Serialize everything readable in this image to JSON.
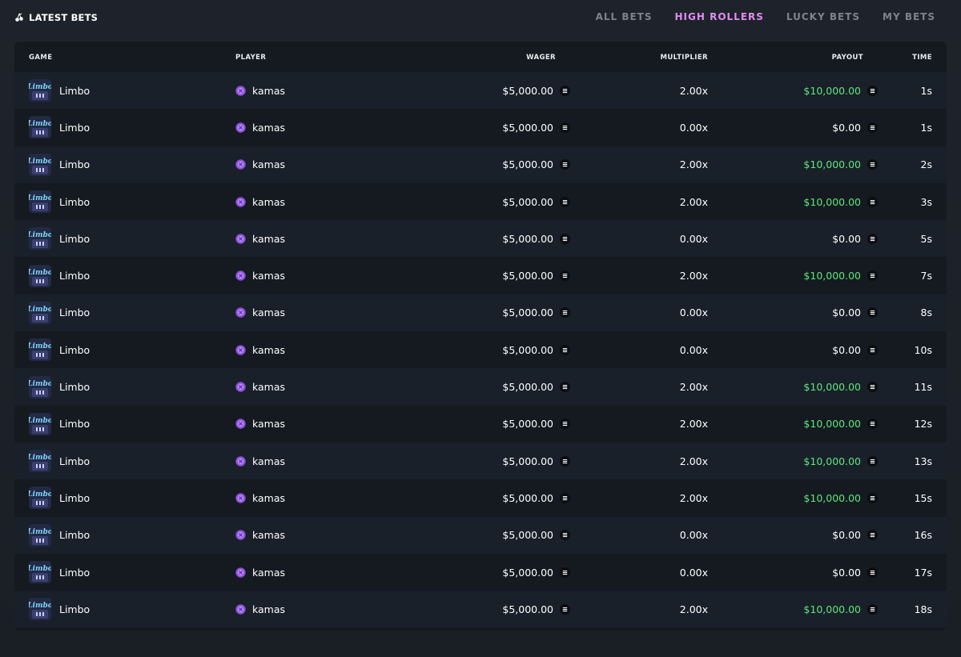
{
  "header": {
    "title": "LATEST BETS",
    "title_icon": "cherries-icon",
    "tabs": [
      {
        "label": "ALL BETS",
        "active": false
      },
      {
        "label": "HIGH ROLLERS",
        "active": true
      },
      {
        "label": "LUCKY BETS",
        "active": false
      },
      {
        "label": "MY BETS",
        "active": false
      }
    ]
  },
  "table": {
    "columns": {
      "game": "GAME",
      "player": "PLAYER",
      "wager": "WAGER",
      "multiplier": "MULTIPLIER",
      "payout": "PAYOUT",
      "time": "TIME"
    },
    "rows": [
      {
        "game": "Limbo",
        "player": "kamas",
        "wager": "$5,000.00",
        "multiplier": "2.00x",
        "payout": "$10,000.00",
        "win": true,
        "time": "1s"
      },
      {
        "game": "Limbo",
        "player": "kamas",
        "wager": "$5,000.00",
        "multiplier": "0.00x",
        "payout": "$0.00",
        "win": false,
        "time": "1s"
      },
      {
        "game": "Limbo",
        "player": "kamas",
        "wager": "$5,000.00",
        "multiplier": "2.00x",
        "payout": "$10,000.00",
        "win": true,
        "time": "2s"
      },
      {
        "game": "Limbo",
        "player": "kamas",
        "wager": "$5,000.00",
        "multiplier": "2.00x",
        "payout": "$10,000.00",
        "win": true,
        "time": "3s"
      },
      {
        "game": "Limbo",
        "player": "kamas",
        "wager": "$5,000.00",
        "multiplier": "0.00x",
        "payout": "$0.00",
        "win": false,
        "time": "5s"
      },
      {
        "game": "Limbo",
        "player": "kamas",
        "wager": "$5,000.00",
        "multiplier": "2.00x",
        "payout": "$10,000.00",
        "win": true,
        "time": "7s"
      },
      {
        "game": "Limbo",
        "player": "kamas",
        "wager": "$5,000.00",
        "multiplier": "0.00x",
        "payout": "$0.00",
        "win": false,
        "time": "8s"
      },
      {
        "game": "Limbo",
        "player": "kamas",
        "wager": "$5,000.00",
        "multiplier": "0.00x",
        "payout": "$0.00",
        "win": false,
        "time": "10s"
      },
      {
        "game": "Limbo",
        "player": "kamas",
        "wager": "$5,000.00",
        "multiplier": "2.00x",
        "payout": "$10,000.00",
        "win": true,
        "time": "11s"
      },
      {
        "game": "Limbo",
        "player": "kamas",
        "wager": "$5,000.00",
        "multiplier": "2.00x",
        "payout": "$10,000.00",
        "win": true,
        "time": "12s"
      },
      {
        "game": "Limbo",
        "player": "kamas",
        "wager": "$5,000.00",
        "multiplier": "2.00x",
        "payout": "$10,000.00",
        "win": true,
        "time": "13s"
      },
      {
        "game": "Limbo",
        "player": "kamas",
        "wager": "$5,000.00",
        "multiplier": "2.00x",
        "payout": "$10,000.00",
        "win": true,
        "time": "15s"
      },
      {
        "game": "Limbo",
        "player": "kamas",
        "wager": "$5,000.00",
        "multiplier": "0.00x",
        "payout": "$0.00",
        "win": false,
        "time": "16s"
      },
      {
        "game": "Limbo",
        "player": "kamas",
        "wager": "$5,000.00",
        "multiplier": "0.00x",
        "payout": "$0.00",
        "win": false,
        "time": "17s"
      },
      {
        "game": "Limbo",
        "player": "kamas",
        "wager": "$5,000.00",
        "multiplier": "2.00x",
        "payout": "$10,000.00",
        "win": true,
        "time": "18s"
      }
    ]
  },
  "icons": {
    "game_thumb": "limbo-game-icon",
    "player": "vip-badge-icon",
    "currency": "coin-icon"
  },
  "colors": {
    "active_tab": "#e28cf0",
    "win": "#5fe67a",
    "background": "#1c2129",
    "panel": "#141a20",
    "row_alt": "#19202a"
  }
}
